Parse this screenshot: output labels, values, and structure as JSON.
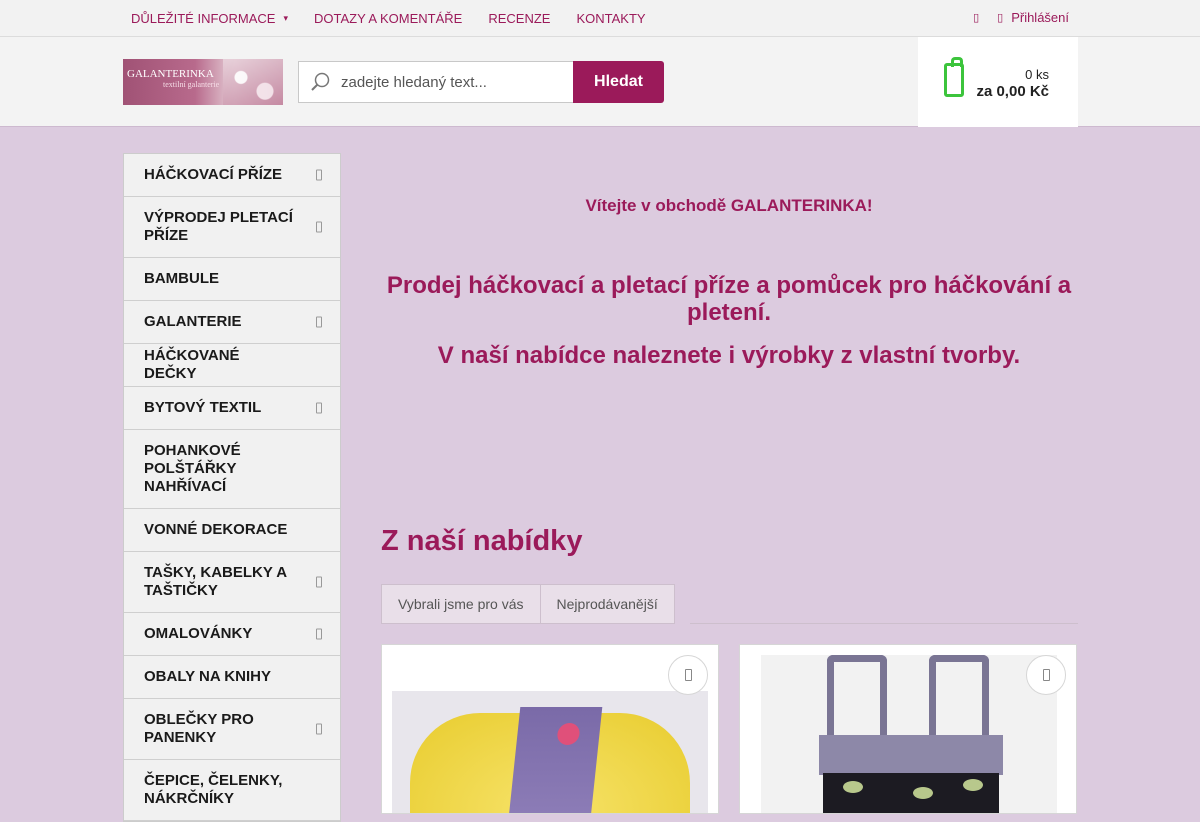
{
  "topbar": {
    "nav": [
      {
        "label": "DŮLEŽITÉ INFORMACE",
        "has_dropdown": true
      },
      {
        "label": "DOTAZY A KOMENTÁŘE",
        "has_dropdown": false
      },
      {
        "label": "RECENZE",
        "has_dropdown": false
      },
      {
        "label": "KONTAKTY",
        "has_dropdown": false
      }
    ],
    "login_label": "Přihlášení"
  },
  "header": {
    "logo_text": "GALANTERINKA",
    "logo_subtext": "textilní galanterie",
    "search_placeholder": "zadejte hledaný text...",
    "search_button": "Hledat",
    "cart_qty": "0 ks",
    "cart_price": "za 0,00 Kč"
  },
  "sidebar": {
    "items": [
      {
        "label": "HÁČKOVACÍ PŘÍZE",
        "has_sub": true
      },
      {
        "label": "VÝPRODEJ PLETACÍ PŘÍZE",
        "has_sub": true
      },
      {
        "label": "BAMBULE",
        "has_sub": false
      },
      {
        "label": "GALANTERIE",
        "has_sub": true
      },
      {
        "label": "HÁČKOVANÉ DEČKY",
        "has_sub": false
      },
      {
        "label": "BYTOVÝ TEXTIL",
        "has_sub": true
      },
      {
        "label": "POHANKOVÉ POLŠTÁŘKY NAHŘÍVACÍ",
        "has_sub": false
      },
      {
        "label": "VONNÉ DEKORACE",
        "has_sub": false
      },
      {
        "label": "TAŠKY, KABELKY A TAŠTIČKY",
        "has_sub": true
      },
      {
        "label": "OMALOVÁNKY",
        "has_sub": true
      },
      {
        "label": "OBALY NA KNIHY",
        "has_sub": false
      },
      {
        "label": "OBLEČKY PRO PANENKY",
        "has_sub": true
      },
      {
        "label": "ČEPICE, ČELENKY, NÁKRČNÍKY",
        "has_sub": false
      }
    ]
  },
  "main": {
    "welcome": "Vítejte v obchodě GALANTERINKA!",
    "hero_line1": "Prodej háčkovací a pletací příze a pomůcek pro háčkování a pletení.",
    "hero_line2": "V naší nabídce naleznete i výrobky z vlastní tvorby.",
    "section_title": "Z naší nabídky",
    "tabs": [
      "Vybrali jsme pro vás",
      "Nejprodávanější"
    ]
  },
  "colors": {
    "accent": "#9b1a5a",
    "background": "#dccbdf",
    "cart_icon": "#3cc43c"
  }
}
